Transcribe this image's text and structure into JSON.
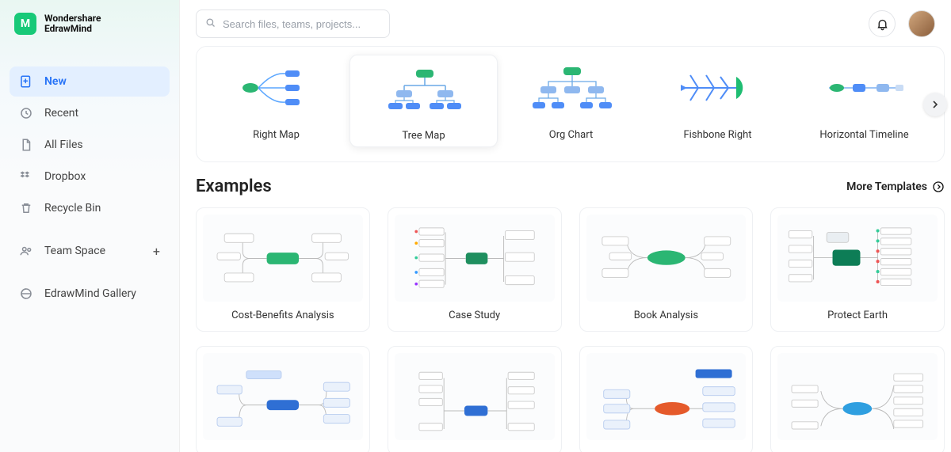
{
  "brand": {
    "line1": "Wondershare",
    "line2": "EdrawMind",
    "logo_letter": "M"
  },
  "search": {
    "placeholder": "Search files, teams, projects..."
  },
  "sidebar": {
    "items": [
      {
        "label": "New",
        "icon": "plus-file-icon",
        "active": true
      },
      {
        "label": "Recent",
        "icon": "clock-icon",
        "active": false
      },
      {
        "label": "All Files",
        "icon": "file-icon",
        "active": false
      },
      {
        "label": "Dropbox",
        "icon": "dropbox-icon",
        "active": false
      },
      {
        "label": "Recycle Bin",
        "icon": "trash-icon",
        "active": false
      }
    ],
    "lower": [
      {
        "label": "Team Space",
        "icon": "team-icon",
        "has_add": true
      },
      {
        "label": "EdrawMind Gallery",
        "icon": "gallery-icon",
        "has_add": false
      }
    ]
  },
  "templates": [
    {
      "name": "Right Map",
      "selected": false
    },
    {
      "name": "Tree Map",
      "selected": true
    },
    {
      "name": "Org Chart",
      "selected": false
    },
    {
      "name": "Fishbone Right",
      "selected": false
    },
    {
      "name": "Horizontal Timeline",
      "selected": false
    }
  ],
  "examples_section": {
    "title": "Examples",
    "more_label": "More Templates"
  },
  "examples_row1": [
    {
      "title": "Cost-Benefits Analysis",
      "accent": "#2bb673"
    },
    {
      "title": "Case Study",
      "accent": "#1f8f5f"
    },
    {
      "title": "Book Analysis",
      "accent": "#2bb673"
    },
    {
      "title": "Protect Earth",
      "accent": "#0d7d56"
    }
  ],
  "examples_row2": [
    {
      "title": "",
      "accent": "#2f6fd4"
    },
    {
      "title": "",
      "accent": "#2f6fd4"
    },
    {
      "title": "",
      "accent": "#e55a2b"
    },
    {
      "title": "",
      "accent": "#2f9fe0"
    }
  ],
  "colors": {
    "primary": "#2773f7",
    "green": "#18c978",
    "blue": "#4f8df7"
  }
}
